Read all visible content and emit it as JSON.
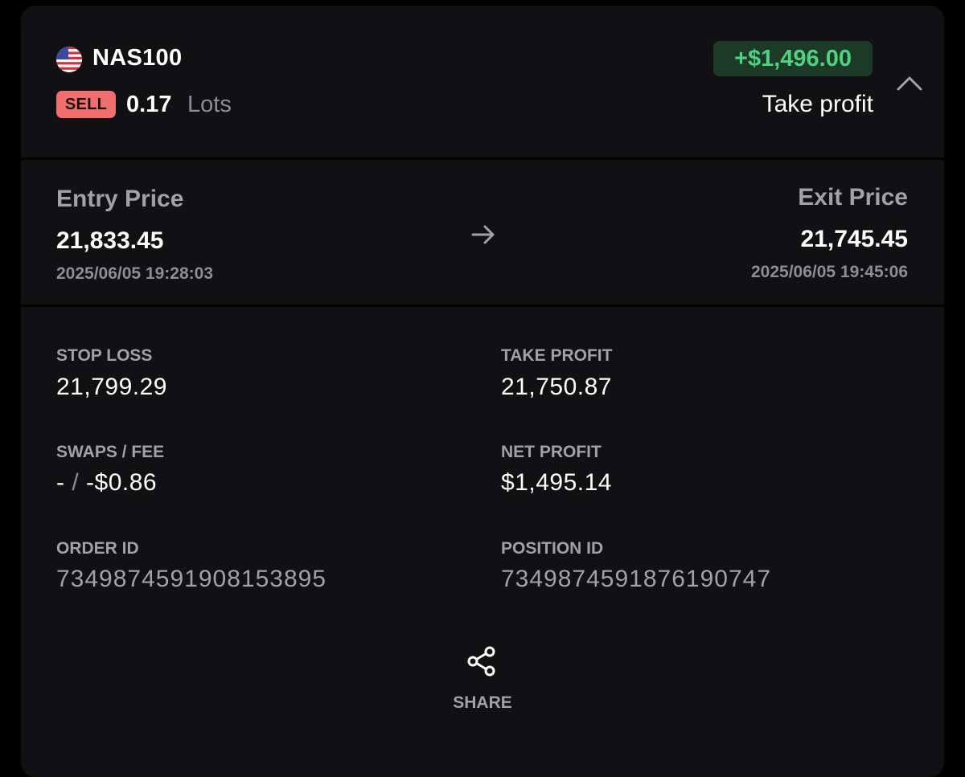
{
  "position": {
    "symbol": "NAS100",
    "flag_icon": "us-flag-icon",
    "side": "SELL",
    "lots": "0.17",
    "lots_unit": "Lots",
    "pnl": "+$1,496.00",
    "close_reason": "Take profit",
    "collapse_icon": "chevron-up-icon"
  },
  "prices": {
    "entry_label": "Entry Price",
    "entry_value": "21,833.45",
    "entry_time": "2025/06/05 19:28:03",
    "arrow_icon": "arrow-right-icon",
    "exit_label": "Exit Price",
    "exit_value": "21,745.45",
    "exit_time": "2025/06/05 19:45:06"
  },
  "details": {
    "stop_loss_label": "STOP LOSS",
    "stop_loss_value": "21,799.29",
    "take_profit_label": "TAKE PROFIT",
    "take_profit_value": "21,750.87",
    "swaps_fee_label": "SWAPS / FEE",
    "swaps_value": "-",
    "fee_separator": "/",
    "fee_value": "-$0.86",
    "net_profit_label": "NET PROFIT",
    "net_profit_value": "$1,495.14",
    "order_id_label": "ORDER ID",
    "order_id_value": "7349874591908153895",
    "position_id_label": "POSITION ID",
    "position_id_value": "7349874591876190747"
  },
  "share": {
    "icon": "share-icon",
    "label": "SHARE"
  },
  "colors": {
    "background": "#000000",
    "card": "#111113",
    "sell_badge": "#f06e6e",
    "profit_text": "#4fd27f",
    "profit_badge_bg": "#1c3a27",
    "muted_text": "#a1a1a6"
  }
}
